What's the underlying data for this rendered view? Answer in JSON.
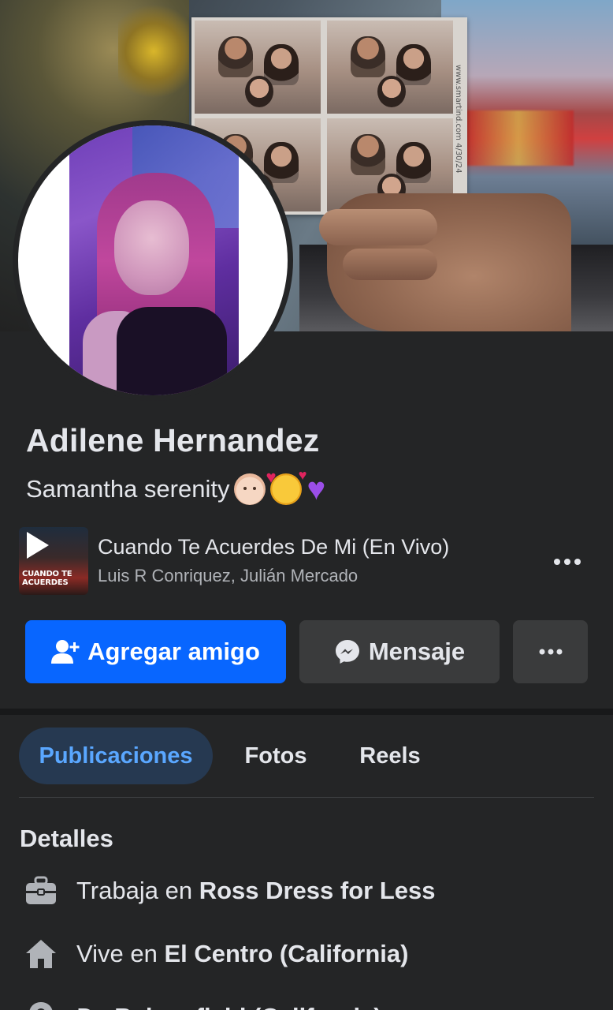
{
  "profile": {
    "name": "Adilene Hernandez",
    "bio_text": "Samantha serenity",
    "bio_emojis": [
      "baby-face-emoji",
      "smiling-face-with-hearts-emoji",
      "purple-heart-emoji"
    ]
  },
  "cover": {
    "photostrip_text": "www.smartind.com  4/30/24"
  },
  "music": {
    "album_text": "CUANDO TE ACUERDES",
    "song_title": "Cuando Te Acuerdes De Mi (En Vivo)",
    "artists": "Luis R Conriquez, Julián Mercado"
  },
  "actions": {
    "add_friend_label": "Agregar amigo",
    "message_label": "Mensaje",
    "more_label": "•••"
  },
  "tabs": [
    {
      "label": "Publicaciones",
      "active": true
    },
    {
      "label": "Fotos",
      "active": false
    },
    {
      "label": "Reels",
      "active": false
    }
  ],
  "details": {
    "title": "Detalles",
    "items": [
      {
        "icon": "briefcase-icon",
        "prefix": "Trabaja en",
        "value": "Ross Dress for Less"
      },
      {
        "icon": "home-icon",
        "prefix": "Vive en",
        "value": "El Centro (California)"
      },
      {
        "icon": "location-pin-icon",
        "prefix": "De",
        "value": "Bakersfield (California)"
      }
    ]
  },
  "colors": {
    "background": "#242526",
    "primary_button": "#0866ff",
    "secondary_button": "#3a3b3c",
    "active_tab_bg": "#263951",
    "active_tab_text": "#5aa7ff",
    "text_primary": "#e4e6eb",
    "text_secondary": "#b0b3b8"
  }
}
